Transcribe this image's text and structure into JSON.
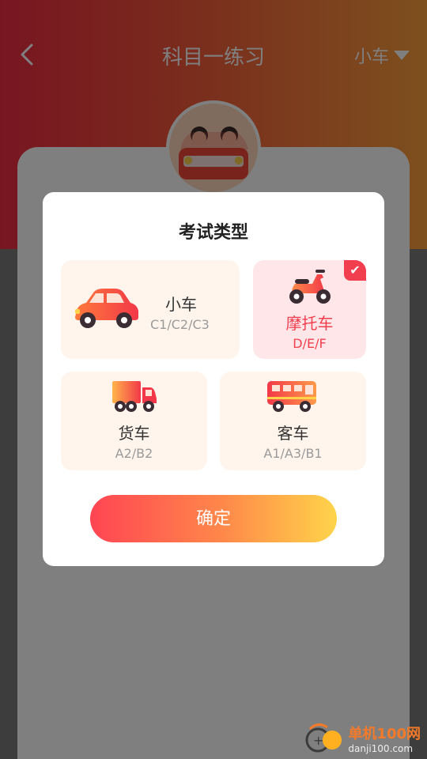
{
  "header": {
    "title": "科目一练习",
    "vehicle_type": "小车",
    "back_icon": "chevron-left-icon",
    "dropdown_icon": "caret-down-icon"
  },
  "dialog": {
    "title": "考试类型",
    "options": [
      {
        "label": "小车",
        "sub": "C1/C2/C3",
        "icon": "car-icon",
        "selected": false
      },
      {
        "label": "摩托车",
        "sub": "D/E/F",
        "icon": "motorcycle-icon",
        "selected": true
      },
      {
        "label": "货车",
        "sub": "A2/B2",
        "icon": "truck-icon",
        "selected": false
      },
      {
        "label": "客车",
        "sub": "A1/A3/B1",
        "icon": "bus-icon",
        "selected": false
      }
    ],
    "confirm_label": "确定"
  },
  "watermark": {
    "name": "单机100网",
    "url": "danji100.com"
  },
  "colors": {
    "accent": "#f23f4f",
    "option_bg": "#fff5ec",
    "selected_bg": "#ffe7e9",
    "button_gradient_start": "#ff4553",
    "button_gradient_end": "#ffd44a"
  }
}
